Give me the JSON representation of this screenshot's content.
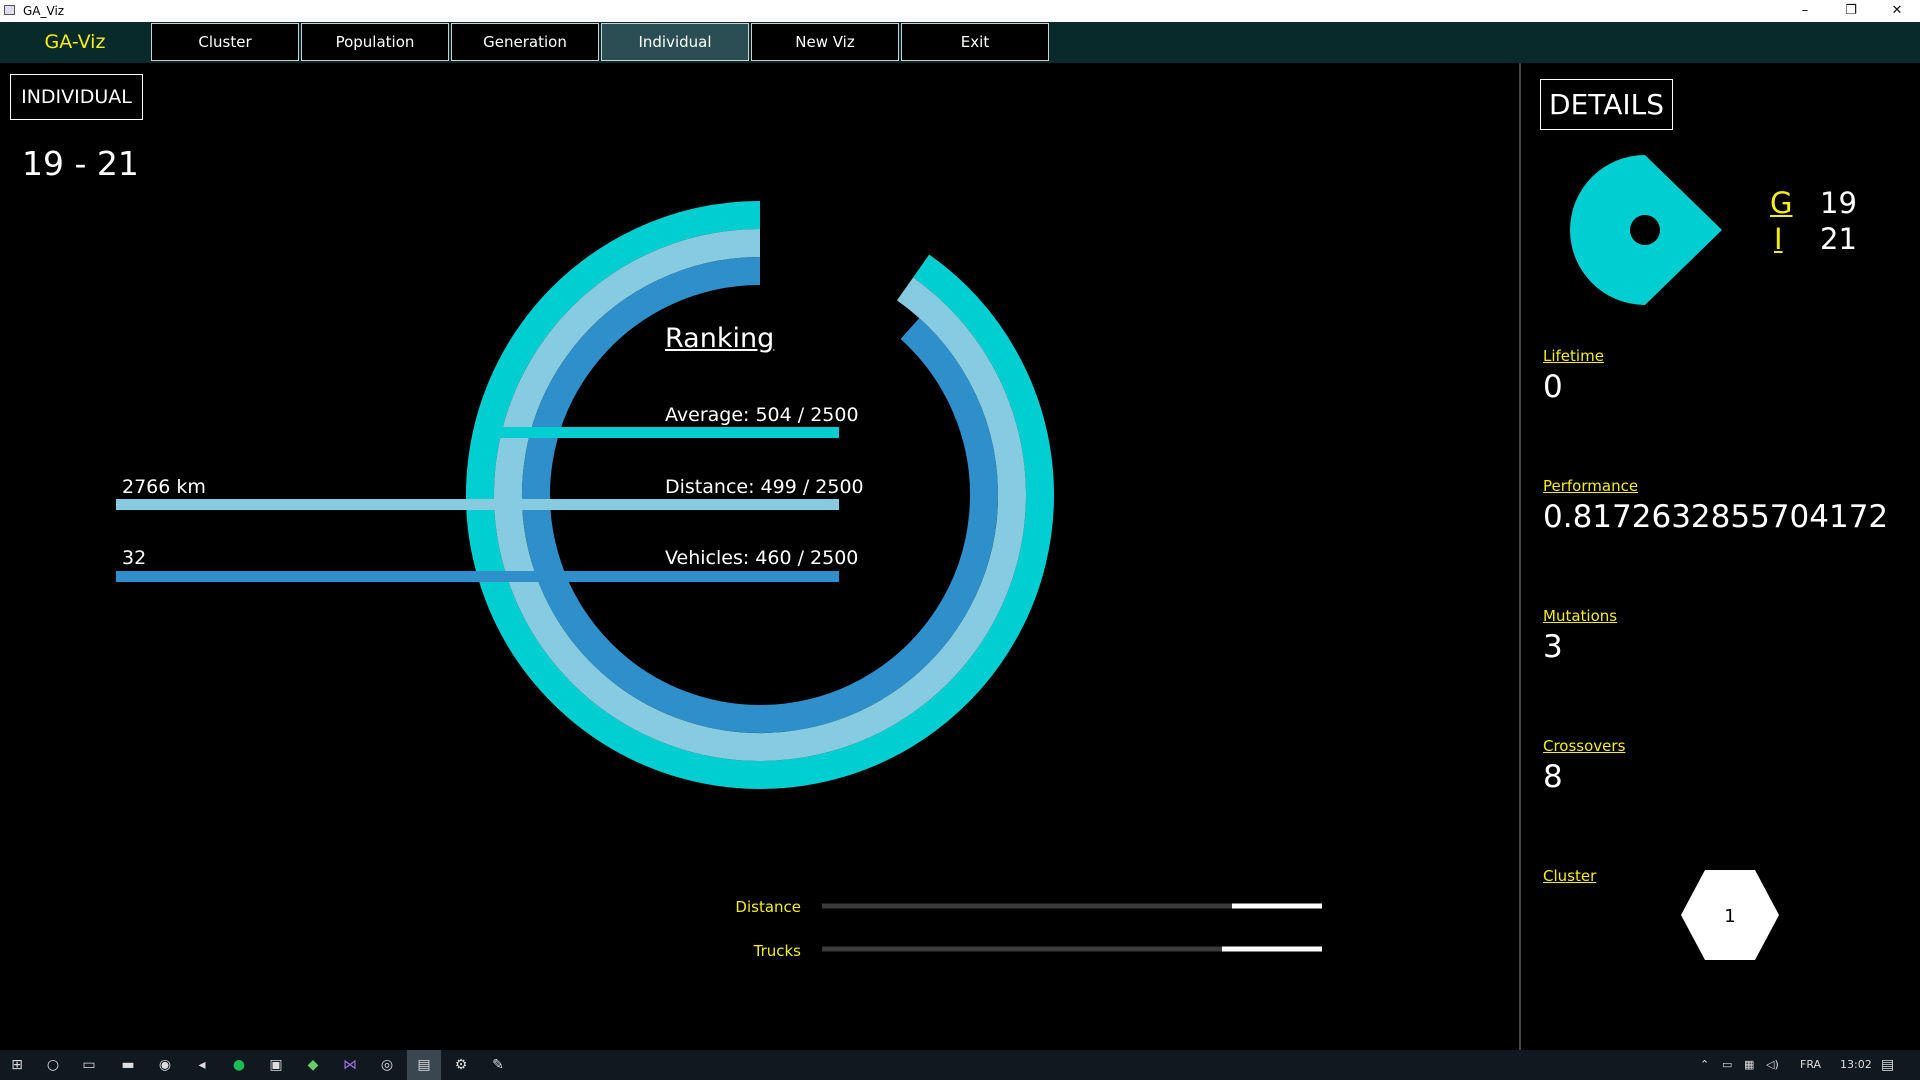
{
  "window": {
    "title": "GA_Viz",
    "minimize": "–",
    "restore": "❐",
    "close": "✕"
  },
  "menu": {
    "brand": "GA-Viz",
    "items": [
      "Cluster",
      "Population",
      "Generation",
      "Individual",
      "New Viz",
      "Exit"
    ],
    "active": "Individual"
  },
  "individual": {
    "label": "INDIVIDUAL",
    "id": "19 - 21"
  },
  "ranking": {
    "title": "Ranking",
    "average": "Average: 504 / 2500",
    "distance": "Distance: 499 / 2500",
    "vehicles": "Vehicles: 460 / 2500",
    "distance_value": "2766 km",
    "vehicles_value": "32"
  },
  "chart_data": {
    "type": "radial-bar",
    "max": 2500,
    "series": [
      {
        "name": "Average",
        "value": 504,
        "color": "#00ced1"
      },
      {
        "name": "Distance",
        "value": 499,
        "color": "#87cbe0"
      },
      {
        "name": "Vehicles",
        "value": 460,
        "color": "#2f8fca"
      }
    ]
  },
  "sliders": [
    {
      "label": "Distance",
      "value": 0.82
    },
    {
      "label": "Trucks",
      "value": 0.8
    }
  ],
  "details": {
    "label": "DETAILS",
    "g_key": "G",
    "g_value": "19",
    "i_key": "I",
    "i_value": "21",
    "lifetime_label": "Lifetime",
    "lifetime": "0",
    "performance_label": "Performance",
    "performance": "0.8172632855704172",
    "mutations_label": "Mutations",
    "mutations": "3",
    "crossovers_label": "Crossovers",
    "crossovers": "8",
    "cluster_label": "Cluster",
    "cluster": "1"
  },
  "taskbar": {
    "icons": [
      "windows-start-icon",
      "cortana-icon",
      "task-view-icon",
      "file-explorer-icon",
      "chrome-icon",
      "media-icon",
      "spotify-icon",
      "discord-icon",
      "game-icon",
      "visual-studio-icon",
      "steam-icon",
      "ga-viz-app-icon",
      "settings-icon",
      "paint-icon"
    ],
    "language": "FRA",
    "time": "13:02"
  },
  "colors": {
    "cyan": "#00ced1",
    "lightblue": "#87cbe0",
    "blue": "#2f8fca",
    "yellow": "#f5ee19"
  }
}
